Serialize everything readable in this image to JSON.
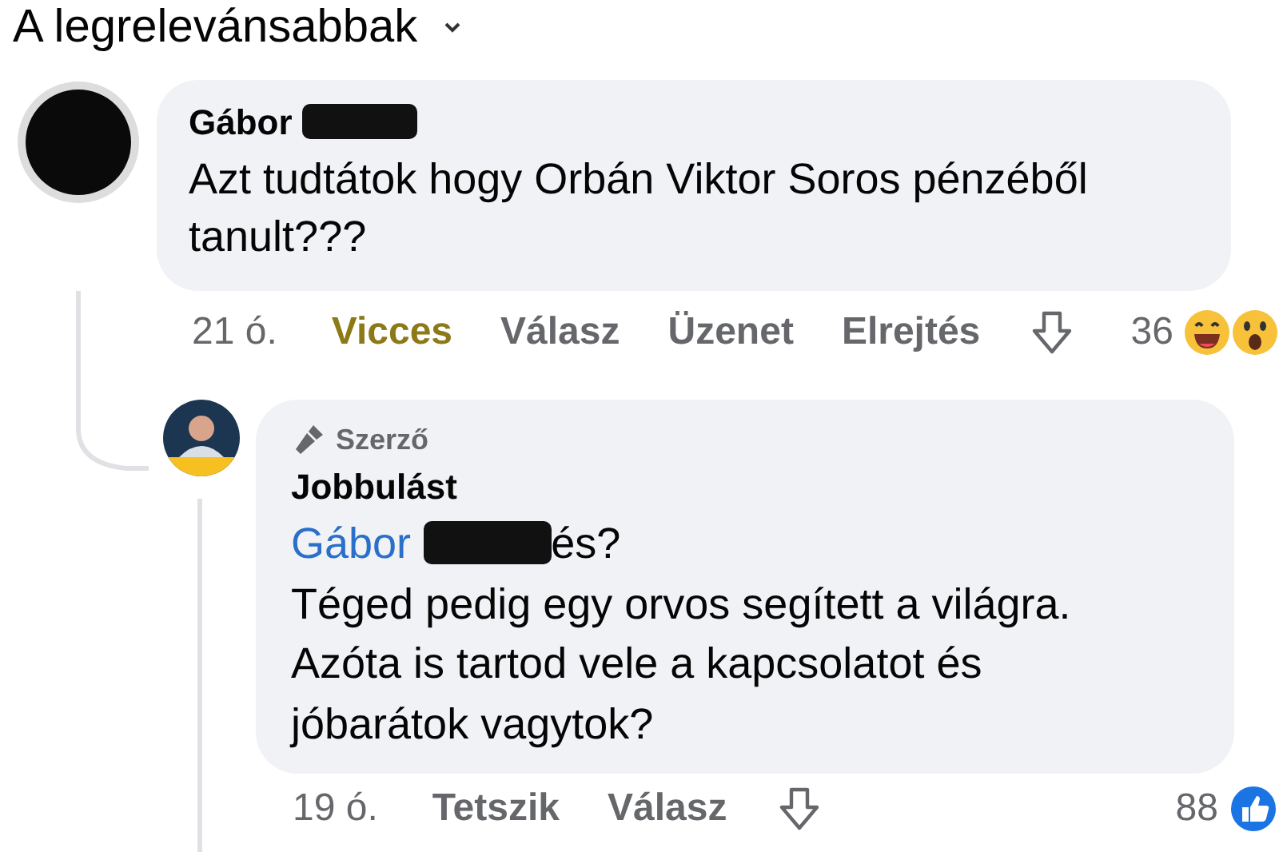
{
  "sort": {
    "label": "A legrelevánsabbak"
  },
  "comment": {
    "author": "Gábor",
    "author_redacted": true,
    "text": "Azt tudtátok hogy Orbán Viktor Soros pénzéből tanult???",
    "time": "21 ó.",
    "actions": [
      {
        "label": "Vicces",
        "active": true
      },
      {
        "label": "Válasz",
        "active": false
      },
      {
        "label": "Üzenet",
        "active": false
      },
      {
        "label": "Elrejtés",
        "active": false
      }
    ],
    "reaction_count": "36",
    "reactions": [
      {
        "kind": "haha"
      },
      {
        "kind": "wow"
      }
    ]
  },
  "reply": {
    "badge": "Szerző",
    "author": "Jobbulást",
    "mention": "Gábor",
    "mention_redacted": true,
    "mention_suffix": "és?",
    "text": "Téged pedig egy orvos segített a világra. Azóta is tartod vele a kapcsolatot és jóbarátok vagytok?",
    "time": "19 ó.",
    "actions": [
      {
        "label": "Tetszik",
        "active": false
      },
      {
        "label": "Válasz",
        "active": false
      }
    ],
    "reaction_count": "88",
    "reactions": [
      {
        "kind": "like"
      }
    ]
  }
}
